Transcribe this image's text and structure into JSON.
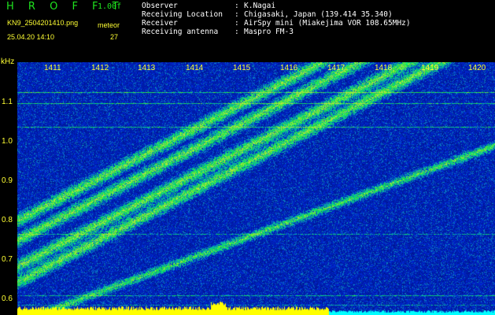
{
  "header": {
    "brand": "H R O F F T",
    "version": "1.00f",
    "filename": "KN9_2504201410.png",
    "meteor_label": "meteor",
    "datetime": "25.04.20 14:10",
    "meteor_count": "27"
  },
  "info": [
    {
      "label": "Observer",
      "value": "K.Nagai"
    },
    {
      "label": "Receiving Location",
      "value": "Chigasaki, Japan (139.414 35.340)"
    },
    {
      "label": "Receiver",
      "value": "AirSpy mini (Miakejima VOR 108.65MHz)"
    },
    {
      "label": "Receiving antenna",
      "value": "Maspro FM-3"
    }
  ],
  "separator": ":",
  "axis": {
    "y_unit": "kHz",
    "y_ticks": [
      "1.1",
      "1.0",
      "0.9",
      "0.8",
      "0.7",
      "0.6"
    ],
    "x_ticks": [
      "1411",
      "1412",
      "1413",
      "1414",
      "1415",
      "1416",
      "1417",
      "1418",
      "1419",
      "1420"
    ]
  },
  "colors": {
    "background": "#000000",
    "label_yellow": "#ffff33",
    "brand_green": "#1fe31f",
    "text_white": "#ffffff",
    "noise_floor": "#0a1fa8",
    "signal_green": "#33e066",
    "bar_yellow": "#ffff00",
    "bar_cyan": "#00ffff"
  }
}
